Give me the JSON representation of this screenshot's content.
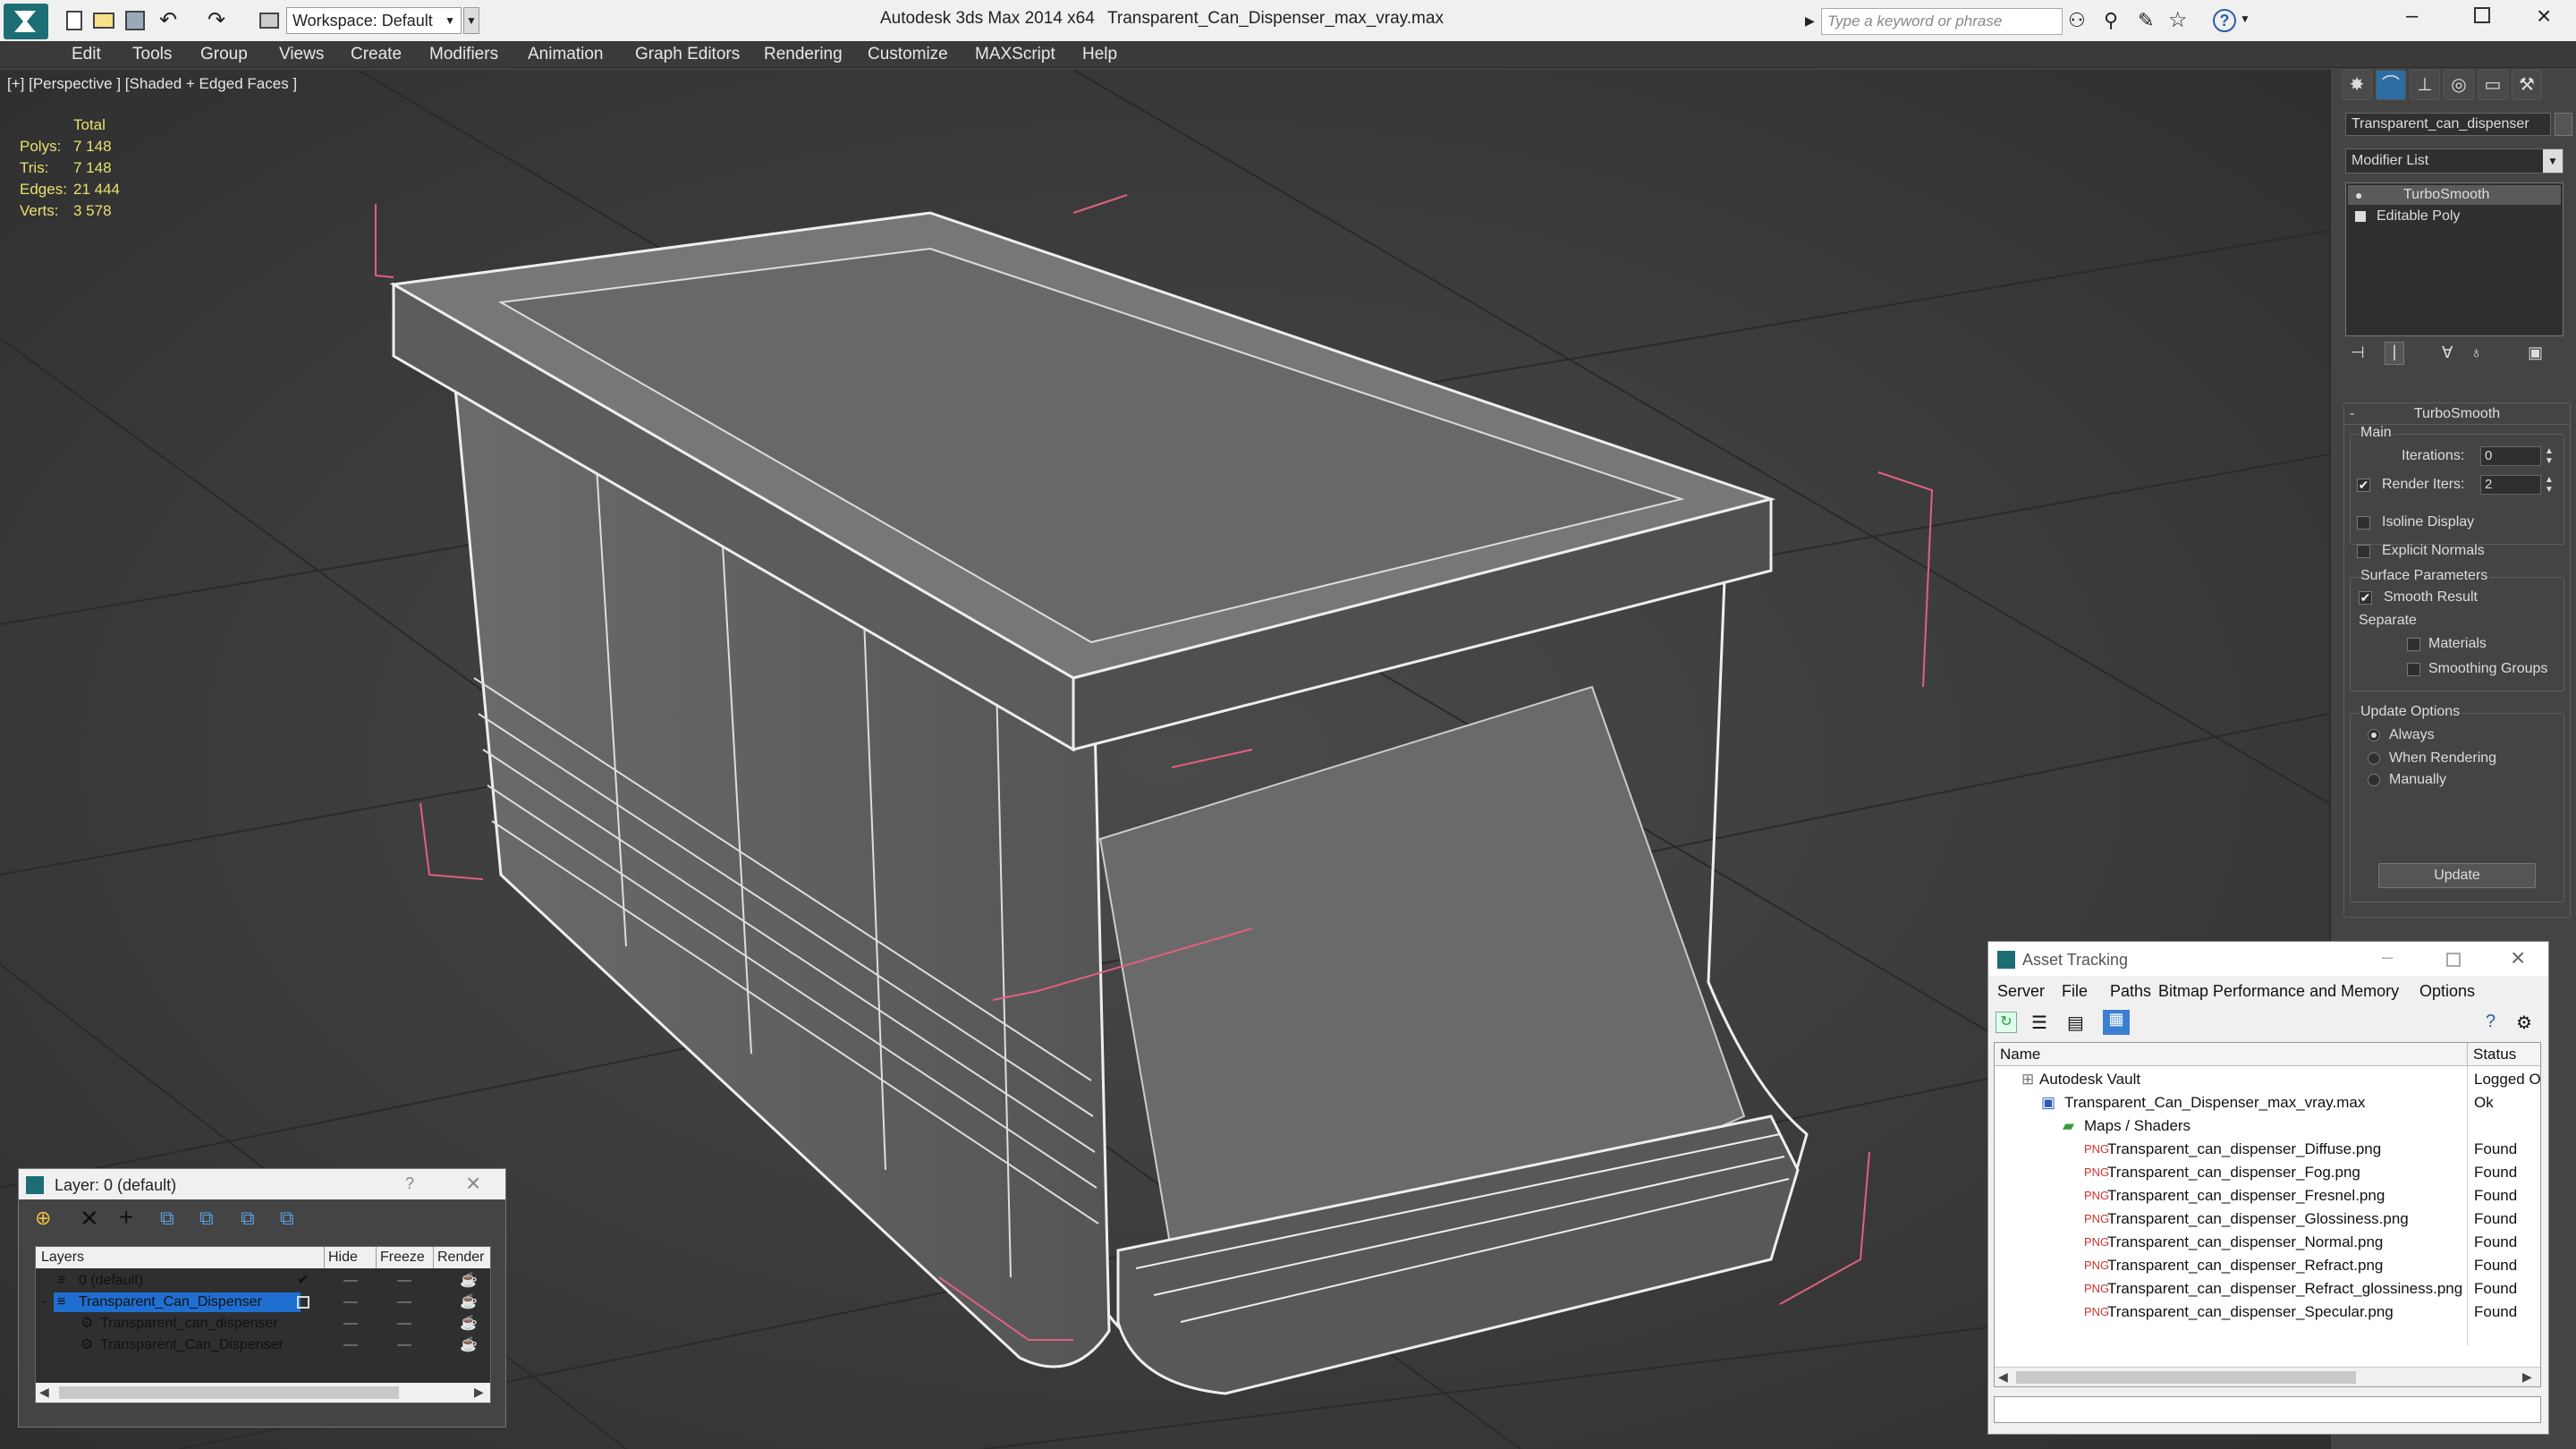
{
  "titlebar": {
    "workspace_label": "Workspace: Default",
    "app_title": "Autodesk 3ds Max  2014 x64",
    "file_name": "Transparent_Can_Dispenser_max_vray.max",
    "search_placeholder": "Type a keyword or phrase"
  },
  "menu": [
    "Edit",
    "Tools",
    "Group",
    "Views",
    "Create",
    "Modifiers",
    "Animation",
    "Graph Editors",
    "Rendering",
    "Customize",
    "MAXScript",
    "Help"
  ],
  "viewport": {
    "label": "[+] [Perspective ] [Shaded + Edged Faces ]",
    "stats": {
      "header": "Total",
      "rows": [
        {
          "label": "Polys:",
          "value": "7 148"
        },
        {
          "label": "Tris:",
          "value": "7 148"
        },
        {
          "label": "Edges:",
          "value": "21 444"
        },
        {
          "label": "Verts:",
          "value": "3 578"
        }
      ]
    }
  },
  "command_panel": {
    "object_name": "Transparent_can_dispenser",
    "modifier_list": "Modifier List",
    "stack": [
      "TurboSmooth",
      "Editable Poly"
    ],
    "rollout_title": "TurboSmooth",
    "main_label": "Main",
    "iterations_label": "Iterations:",
    "iterations_value": "0",
    "render_iters_label": "Render Iters:",
    "render_iters_value": "2",
    "isoline_label": "Isoline Display",
    "explicit_normals_label": "Explicit Normals",
    "surface_params_label": "Surface Parameters",
    "smooth_result_label": "Smooth Result",
    "separate_label": "Separate",
    "materials_label": "Materials",
    "smoothing_groups_label": "Smoothing Groups",
    "update_options_label": "Update Options",
    "always_label": "Always",
    "when_rendering_label": "When Rendering",
    "manually_label": "Manually",
    "update_button": "Update"
  },
  "layer_dialog": {
    "title": "Layer: 0 (default)",
    "help": "?",
    "columns": [
      "Layers",
      "Hide",
      "Freeze",
      "Render"
    ],
    "rows": [
      {
        "name": "0 (default)"
      },
      {
        "name": "Transparent_Can_Dispenser"
      },
      {
        "name": "Transparent_can_dispenser"
      },
      {
        "name": "Transparent_Can_Dispenser"
      }
    ]
  },
  "asset_tracking": {
    "title": "Asset Tracking",
    "menu": [
      "Server",
      "File",
      "Paths",
      "Bitmap Performance and Memory",
      "Options"
    ],
    "columns": [
      "Name",
      "Status"
    ],
    "rows": [
      {
        "name": "Autodesk Vault",
        "status": "Logged Out"
      },
      {
        "name": "Transparent_Can_Dispenser_max_vray.max",
        "status": "Ok"
      },
      {
        "name": "Maps / Shaders",
        "status": ""
      },
      {
        "name": "Transparent_can_dispenser_Diffuse.png",
        "status": "Found"
      },
      {
        "name": "Transparent_can_dispenser_Fog.png",
        "status": "Found"
      },
      {
        "name": "Transparent_can_dispenser_Fresnel.png",
        "status": "Found"
      },
      {
        "name": "Transparent_can_dispenser_Glossiness.png",
        "status": "Found"
      },
      {
        "name": "Transparent_can_dispenser_Normal.png",
        "status": "Found"
      },
      {
        "name": "Transparent_can_dispenser_Refract.png",
        "status": "Found"
      },
      {
        "name": "Transparent_can_dispenser_Refract_glossiness.png",
        "status": "Found"
      },
      {
        "name": "Transparent_can_dispenser_Specular.png",
        "status": "Found"
      }
    ]
  },
  "colors": {
    "accent": "#3399ff",
    "selection": "#1f6fd0",
    "stats_text": "#e6e070"
  }
}
